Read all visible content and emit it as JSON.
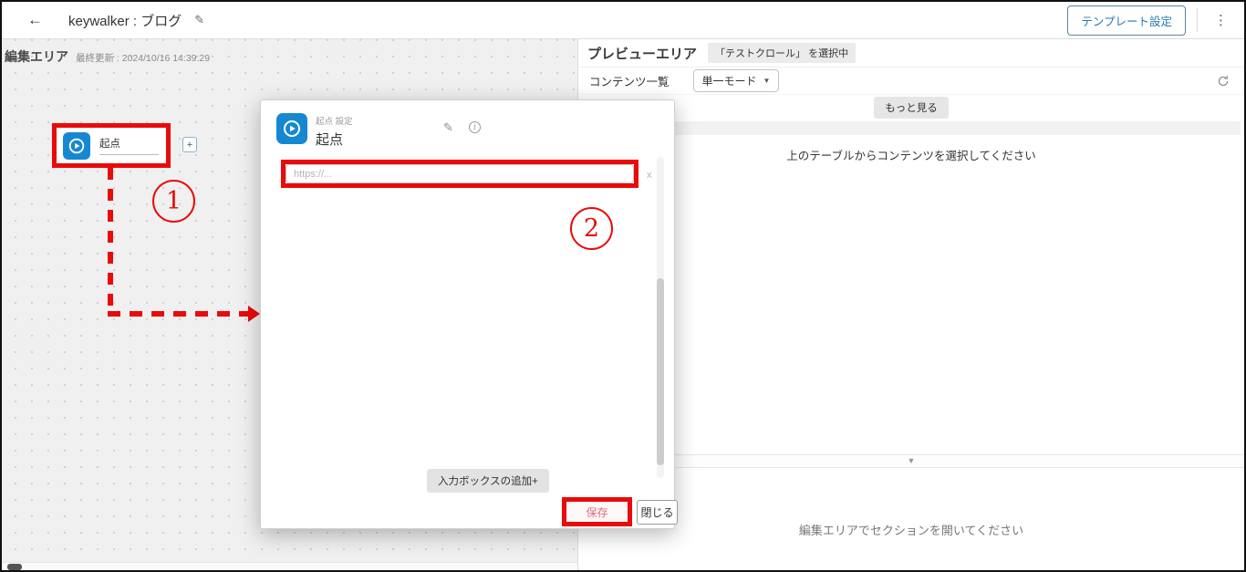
{
  "top_bar": {
    "back_icon": "←",
    "title": "keywalker : ブログ",
    "edit_icon": "✎",
    "template_settings_label": "テンプレート設定",
    "menu_icon": "⋮"
  },
  "edit_area": {
    "title": "編集エリア",
    "last_updated": "最終更新 : 2024/10/16 14:39:29",
    "node": {
      "label": "起点"
    },
    "add_node_label": "+",
    "annotation_1": "1"
  },
  "modal": {
    "subtitle": "起点 設定",
    "title": "起点",
    "edit_icon": "✎",
    "info_icon": "i",
    "input_placeholder": "https://...",
    "remove_input_label": "x",
    "annotation_2": "2",
    "add_input_button": "入力ボックスの追加+",
    "save_button": "保存",
    "close_button": "閉じる"
  },
  "preview_area": {
    "title": "プレビューエリア",
    "selection_badge": "「テストクロール」 を選択中",
    "content_list_label": "コンテンツ一覧",
    "mode_dropdown": "単一モード",
    "dropdown_caret": "▼",
    "more_button": "もっと見る",
    "empty_table_message": "上のテーブルからコンテンツを選択してください",
    "collapse_icon": "▼",
    "empty_section_message": "編集エリアでセクションを開いてください"
  },
  "colors": {
    "accent_blue": "#1688d2",
    "annotation_red": "#ea0a0a",
    "save_pink": "#e26a7c",
    "canvas_gray": "#f0f0f0"
  }
}
